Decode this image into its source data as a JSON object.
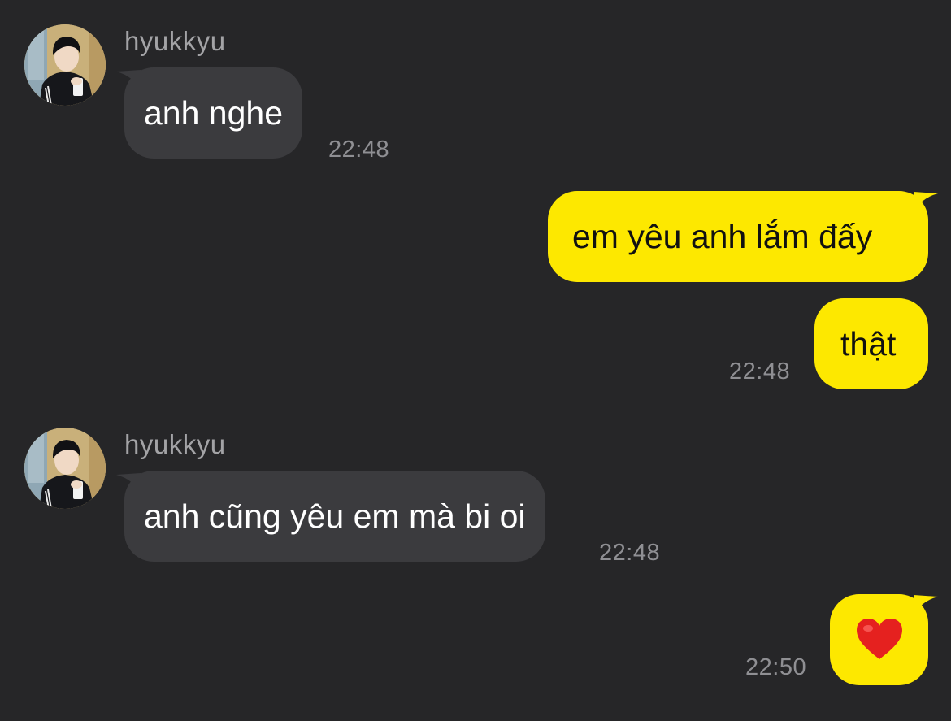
{
  "colors": {
    "background": "#262628",
    "incoming_bubble": "#3b3b3e",
    "outgoing_bubble": "#fde800",
    "timestamp": "#8f8f93",
    "sender_name": "#a3a3a6"
  },
  "messages": [
    {
      "direction": "incoming",
      "sender": "hyukkyu",
      "avatar_icon": "profile-photo",
      "text": "anh nghe",
      "time": "22:48"
    },
    {
      "direction": "outgoing",
      "text": "em yêu anh lắm đấy"
    },
    {
      "direction": "outgoing",
      "text": "thật",
      "time": "22:48"
    },
    {
      "direction": "incoming",
      "sender": "hyukkyu",
      "avatar_icon": "profile-photo",
      "text": "anh cũng yêu em mà bi oi",
      "time": "22:48"
    },
    {
      "direction": "outgoing",
      "text": "❤️",
      "emoji_icon": "red-heart",
      "time": "22:50"
    }
  ]
}
